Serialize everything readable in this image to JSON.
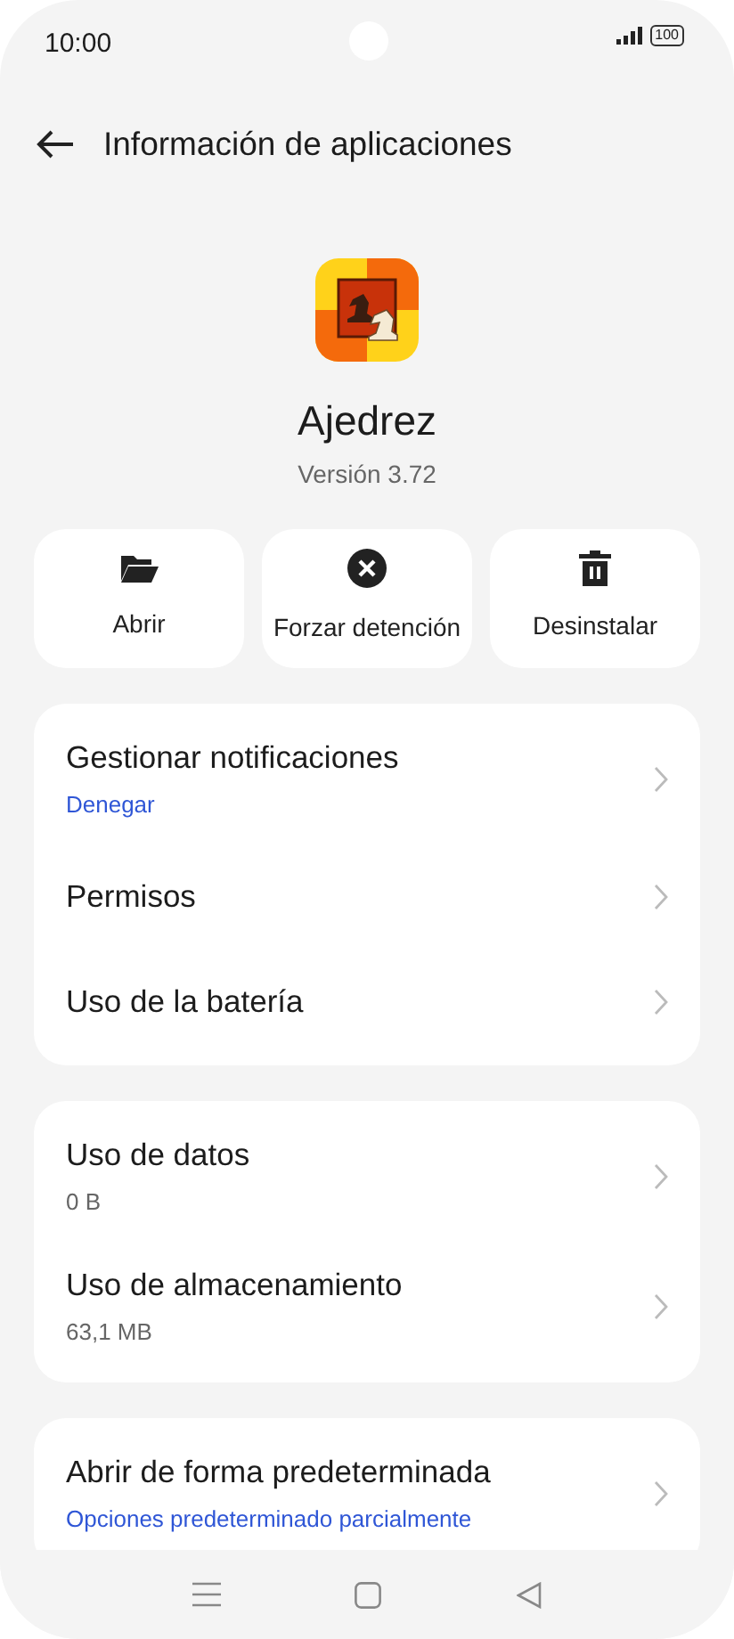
{
  "status_bar": {
    "time": "10:00",
    "battery": "100"
  },
  "header": {
    "title": "Información de aplicaciones"
  },
  "app": {
    "name": "Ajedrez",
    "version": "Versión 3.72"
  },
  "actions": [
    {
      "kind": "folder",
      "label": "Abrir"
    },
    {
      "kind": "stop",
      "label": "Forzar detención"
    },
    {
      "kind": "trash",
      "label": "Desinstalar"
    }
  ],
  "sections": [
    {
      "rows": [
        {
          "kind": "link",
          "title": "Gestionar notificaciones",
          "subtitle": "Denegar"
        },
        {
          "kind": "plain",
          "title": "Permisos"
        },
        {
          "kind": "plain",
          "title": "Uso de la batería"
        }
      ]
    },
    {
      "rows": [
        {
          "kind": "value",
          "title": "Uso de datos",
          "subtitle": "0 B"
        },
        {
          "kind": "value",
          "title": "Uso de almacenamiento",
          "subtitle": "63,1 MB"
        }
      ]
    },
    {
      "rows": [
        {
          "kind": "link",
          "title": "Abrir de forma predeterminada",
          "subtitle": "Opciones predeterminado parcialmente"
        }
      ]
    }
  ]
}
